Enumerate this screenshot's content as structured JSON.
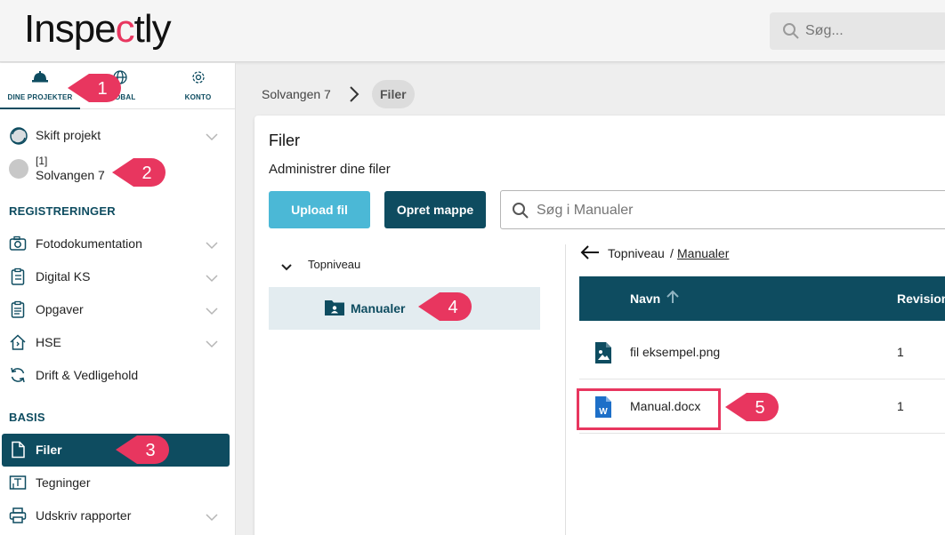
{
  "header": {
    "logo": "Inspectly",
    "search_placeholder": "Søg..."
  },
  "sidebar": {
    "tabs": [
      {
        "label": "DINE PROJEKTER",
        "icon": "hardhat-icon",
        "active": true
      },
      {
        "label": "GLOBAL",
        "icon": "globe-icon",
        "active": false
      },
      {
        "label": "KONTO",
        "icon": "gear-icon",
        "active": false
      }
    ],
    "switch_project": "Skift projekt",
    "project": {
      "number": "[1]",
      "name": "Solvangen 7"
    },
    "section_registreringer": "REGISTRERINGER",
    "registreringer": [
      {
        "label": "Fotodokumentation",
        "icon": "camera-icon"
      },
      {
        "label": "Digital KS",
        "icon": "clipboard-icon"
      },
      {
        "label": "Opgaver",
        "icon": "tasks-icon"
      },
      {
        "label": "HSE",
        "icon": "house-icon"
      },
      {
        "label": "Drift & Vedligehold",
        "icon": "refresh-icon"
      }
    ],
    "section_basis": "BASIS",
    "basis": [
      {
        "label": "Filer",
        "icon": "file-icon",
        "active": true
      },
      {
        "label": "Tegninger",
        "icon": "drawing-icon"
      },
      {
        "label": "Udskriv rapporter",
        "icon": "printer-icon"
      }
    ]
  },
  "breadcrumb": {
    "root": "Solvangen 7",
    "current": "Filer"
  },
  "main": {
    "title": "Filer",
    "subtitle": "Administrer dine filer",
    "upload_button": "Upload fil",
    "create_folder_button": "Opret mappe",
    "folder_search_placeholder": "Søg i Manualer",
    "tree": {
      "root": "Topniveau",
      "selected": "Manualer"
    },
    "path": {
      "root": "Topniveau",
      "separator": "/",
      "current": "Manualer"
    },
    "table": {
      "columns": [
        "Navn",
        "Revision"
      ],
      "rows": [
        {
          "name": "fil eksempel.png",
          "revision": "1",
          "icon": "image-file-icon"
        },
        {
          "name": "Manual.docx",
          "revision": "1",
          "icon": "word-file-icon"
        }
      ]
    }
  },
  "callouts": [
    "1",
    "2",
    "3",
    "4",
    "5"
  ],
  "colors": {
    "brand": "#0e4c60",
    "accent": "#e8365f",
    "upload": "#4bb8d6"
  }
}
